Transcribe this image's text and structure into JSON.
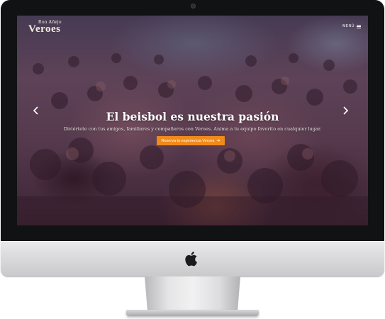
{
  "site": {
    "logo_small": "Ron Añejo",
    "logo_main": "Veroes",
    "menu_label": "MENÚ"
  },
  "hero": {
    "headline": "El beisbol es nuestra pasión",
    "subtext": "Diviértete con tus amigos, familiares y compañeros con Veroes. Anima a tu equipo favorito en cualquier lugar.",
    "cta_label": "Reserva tu experiencia Veroes",
    "cta_icon": "arrow-right-icon",
    "prev_icon": "chevron-left-icon",
    "next_icon": "chevron-right-icon"
  },
  "colors": {
    "cta_background": "#f08a1a",
    "device_bezel": "#111214",
    "device_chin": "#dcdcde"
  }
}
